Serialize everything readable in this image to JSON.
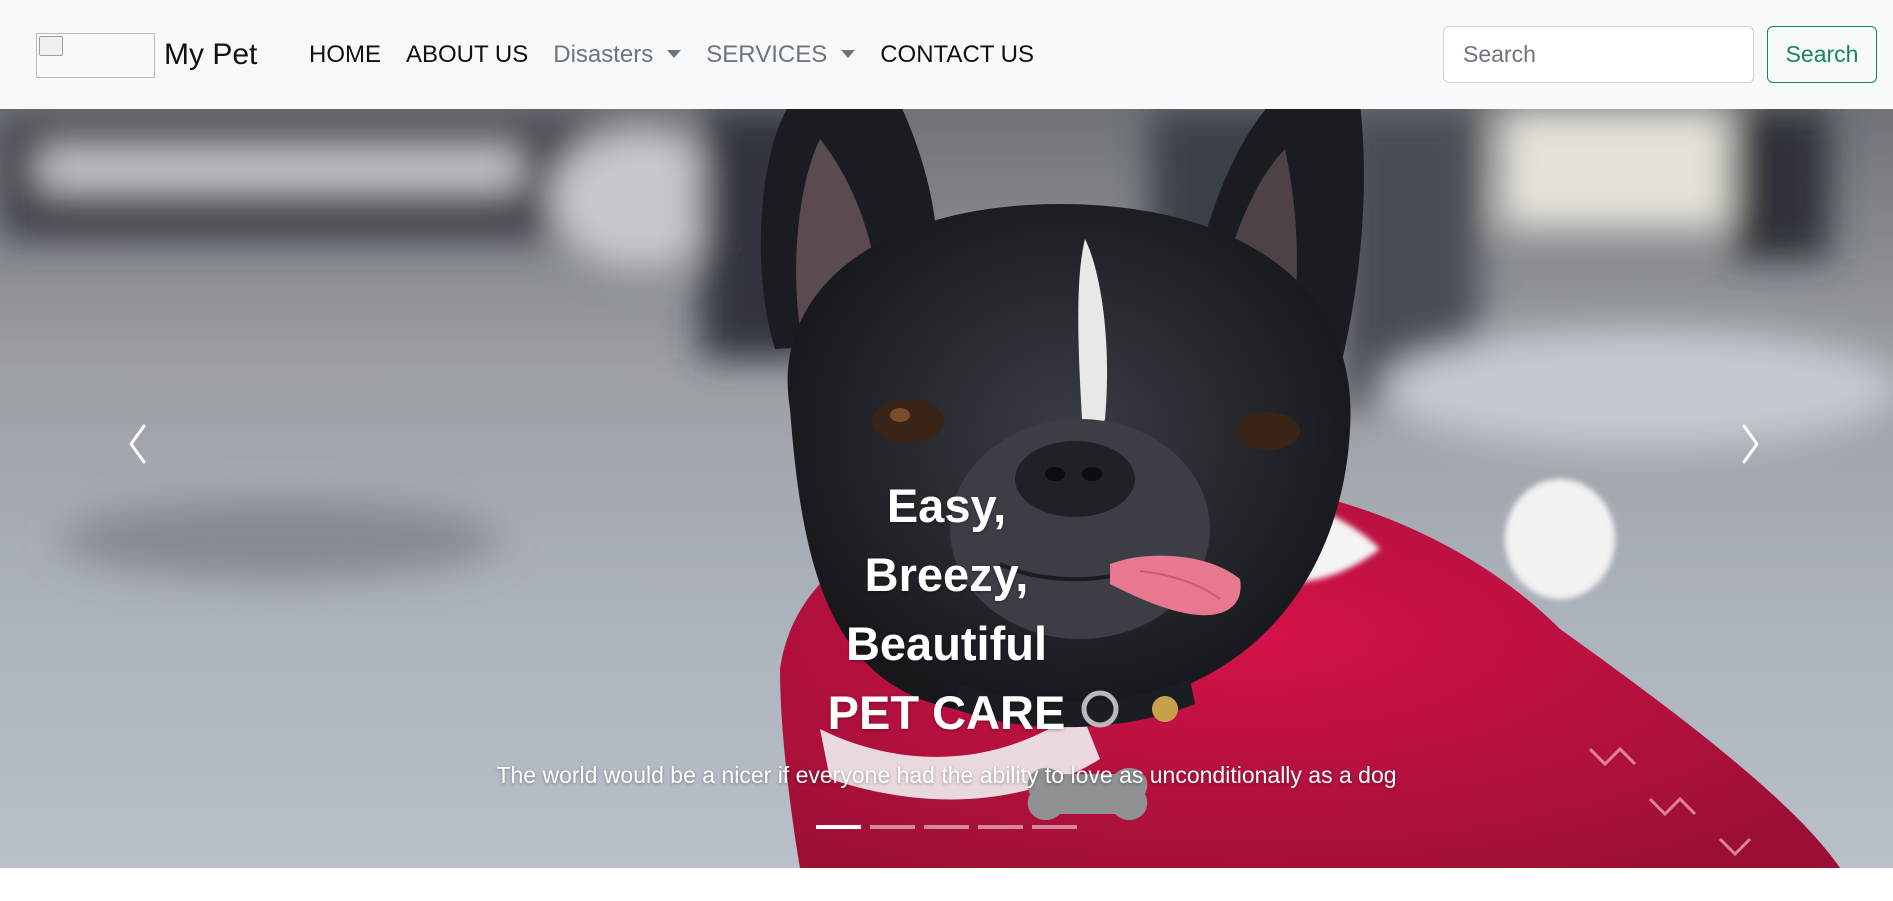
{
  "navbar": {
    "brand_text": "My Pet",
    "links": [
      {
        "label": "HOME"
      },
      {
        "label": "ABOUT US"
      },
      {
        "label": "Disasters"
      },
      {
        "label": "SERVICES"
      },
      {
        "label": "CONTACT US"
      }
    ],
    "search": {
      "placeholder": "Search",
      "button_label": "Search"
    }
  },
  "carousel": {
    "caption_lines": [
      "Easy,",
      "Breezy,",
      "Beautiful",
      "PET CARE"
    ],
    "caption_sub": "The world would be a nicer if everyone had the ability to love as unconditionally as a dog",
    "slide_count": 5,
    "active_slide": 1,
    "prev_icon": "chevron-left-icon",
    "next_icon": "chevron-right-icon"
  },
  "colors": {
    "navbar_bg": "#f8f9fa",
    "search_button": "#198754",
    "muted_link": "#6c757d",
    "caption_text": "#ffffff"
  }
}
